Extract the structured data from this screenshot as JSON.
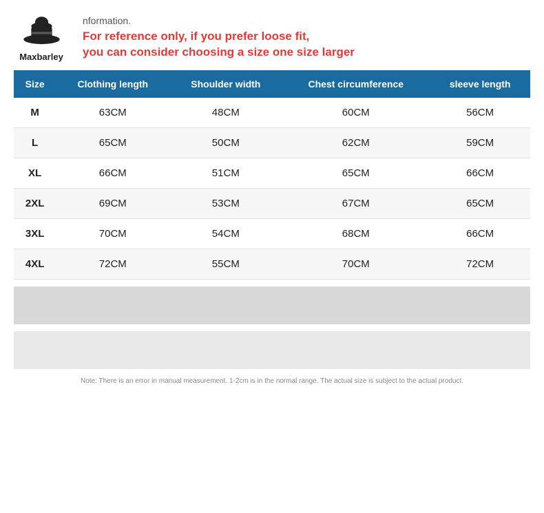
{
  "brand": {
    "name": "Maxbarley",
    "sub_text": "nformation."
  },
  "header_note": {
    "line1": "For reference only, if you prefer loose fit,",
    "line2": "you can consider choosing a size one size larger"
  },
  "table": {
    "headers": [
      "Size",
      "Clothing length",
      "Shoulder width",
      "Chest circumference",
      "sleeve length"
    ],
    "rows": [
      {
        "size": "M",
        "clothing_length": "63CM",
        "shoulder_width": "48CM",
        "chest": "60CM",
        "sleeve": "56CM"
      },
      {
        "size": "L",
        "clothing_length": "65CM",
        "shoulder_width": "50CM",
        "chest": "62CM",
        "sleeve": "59CM"
      },
      {
        "size": "XL",
        "clothing_length": "66CM",
        "shoulder_width": "51CM",
        "chest": "65CM",
        "sleeve": "66CM"
      },
      {
        "size": "2XL",
        "clothing_length": "69CM",
        "shoulder_width": "53CM",
        "chest": "67CM",
        "sleeve": "65CM"
      },
      {
        "size": "3XL",
        "clothing_length": "70CM",
        "shoulder_width": "54CM",
        "chest": "68CM",
        "sleeve": "66CM"
      },
      {
        "size": "4XL",
        "clothing_length": "72CM",
        "shoulder_width": "55CM",
        "chest": "70CM",
        "sleeve": "72CM"
      }
    ]
  },
  "note": "Note: There is an error in manual measurement. 1-2cm is in the normal range. The actual size is subject to the actual product."
}
